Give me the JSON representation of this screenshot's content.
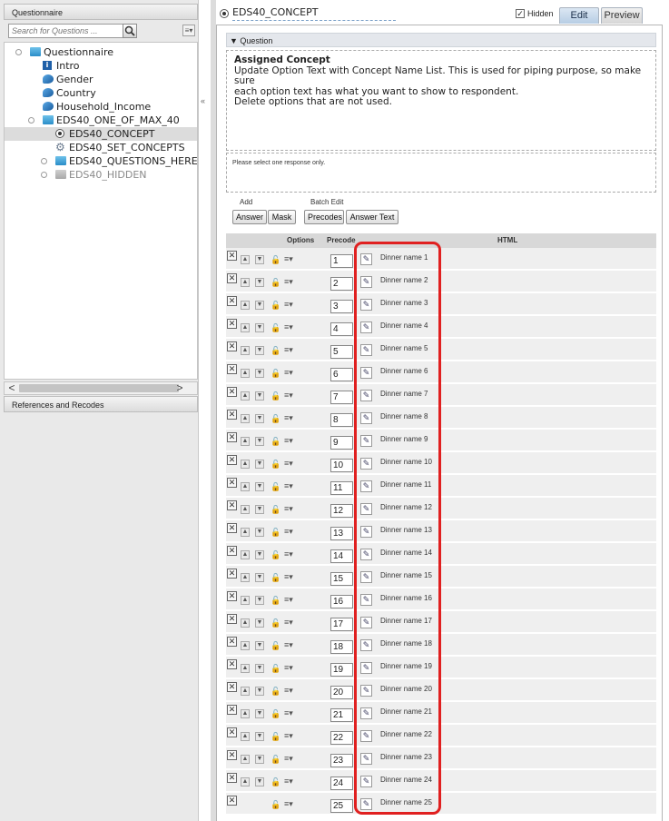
{
  "left_panel": {
    "header": "Questionnaire",
    "search_placeholder": "Search for Questions ...",
    "filter_label": "≡▾",
    "tree": [
      {
        "label": "Questionnaire",
        "icon": "folder-icon",
        "level": 0,
        "expandable": true
      },
      {
        "label": "Intro",
        "icon": "info-icon",
        "level": 1
      },
      {
        "label": "Gender",
        "icon": "question-icon",
        "level": 1
      },
      {
        "label": "Country",
        "icon": "question-icon",
        "level": 1
      },
      {
        "label": "Household_Income",
        "icon": "question-icon",
        "level": 1
      },
      {
        "label": "EDS40_ONE_OF_MAX_40",
        "icon": "folder-icon",
        "level": 1,
        "expandable": true
      },
      {
        "label": "EDS40_CONCEPT",
        "icon": "radio-icon",
        "level": 2,
        "selected": true
      },
      {
        "label": "EDS40_SET_CONCEPTS",
        "icon": "gear-icon",
        "level": 2
      },
      {
        "label": "EDS40_QUESTIONS_HERE",
        "icon": "folder-icon",
        "level": 2,
        "expandable": true
      },
      {
        "label": "EDS40_HIDDEN",
        "icon": "folder-grey-icon",
        "level": 2,
        "expandable": true,
        "greyed": true
      }
    ],
    "references_header": "References and Recodes"
  },
  "top_bar": {
    "question_name": "EDS40_CONCEPT",
    "hidden_label": "Hidden",
    "hidden_checked": true,
    "tab_edit": "Edit",
    "tab_preview": "Preview"
  },
  "question": {
    "section_header": "▼ Question",
    "title": "Assigned Concept",
    "body_line1": "Update Option Text with Concept Name List. This is used for piping purpose, so make sure",
    "body_line2": "each option text has what you want to show to respondent.",
    "body_line3": "Delete options that are not used.",
    "instruction": "Please select one response only."
  },
  "toolbar": {
    "add_label": "Add",
    "batch_edit_label": "Batch Edit",
    "answer_btn": "Answer",
    "mask_btn": "Mask",
    "precodes_btn": "Precodes",
    "answer_text_btn": "Answer Text"
  },
  "grid": {
    "col_options": "Options",
    "col_precode": "Precode",
    "col_html": "HTML",
    "rows": [
      {
        "precode": "1",
        "name": "Dinner name 1"
      },
      {
        "precode": "2",
        "name": "Dinner name 2"
      },
      {
        "precode": "3",
        "name": "Dinner name 3"
      },
      {
        "precode": "4",
        "name": "Dinner name 4"
      },
      {
        "precode": "5",
        "name": "Dinner name 5"
      },
      {
        "precode": "6",
        "name": "Dinner name 6"
      },
      {
        "precode": "7",
        "name": "Dinner name 7"
      },
      {
        "precode": "8",
        "name": "Dinner name 8"
      },
      {
        "precode": "9",
        "name": "Dinner name 9"
      },
      {
        "precode": "10",
        "name": "Dinner name 10"
      },
      {
        "precode": "11",
        "name": "Dinner name 11"
      },
      {
        "precode": "12",
        "name": "Dinner name 12"
      },
      {
        "precode": "13",
        "name": "Dinner name 13"
      },
      {
        "precode": "14",
        "name": "Dinner name 14"
      },
      {
        "precode": "15",
        "name": "Dinner name 15"
      },
      {
        "precode": "16",
        "name": "Dinner name 16"
      },
      {
        "precode": "17",
        "name": "Dinner name 17"
      },
      {
        "precode": "18",
        "name": "Dinner name 18"
      },
      {
        "precode": "19",
        "name": "Dinner name 19"
      },
      {
        "precode": "20",
        "name": "Dinner name 20"
      },
      {
        "precode": "21",
        "name": "Dinner name 21"
      },
      {
        "precode": "22",
        "name": "Dinner name 22"
      },
      {
        "precode": "23",
        "name": "Dinner name 23"
      },
      {
        "precode": "24",
        "name": "Dinner name 24"
      },
      {
        "precode": "25",
        "name": "Dinner name 25"
      }
    ]
  },
  "colors": {
    "highlight": "#e02020",
    "tab_active": "#b7cde4",
    "row_bg": "#efefef"
  }
}
